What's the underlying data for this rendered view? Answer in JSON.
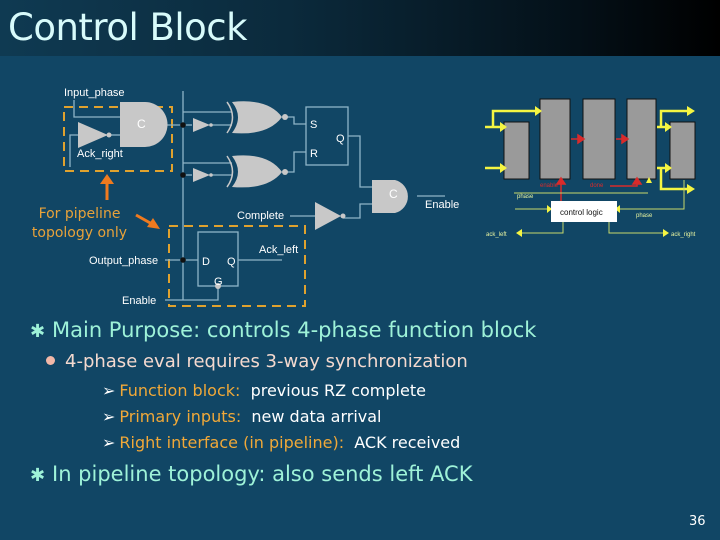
{
  "slide": {
    "title": "Control Block",
    "page_number": "36"
  },
  "circuit": {
    "labels": {
      "input_phase": "Input_phase",
      "ack_right": "Ack_right",
      "c_gate": "C",
      "s": "S",
      "r": "R",
      "q": "Q",
      "complete": "Complete",
      "enable_out": "Enable",
      "ack_left": "Ack_left",
      "output_phase": "Output_phase",
      "d": "D",
      "g": "G",
      "enable_in": "Enable"
    },
    "annotation": [
      "For pipeline",
      "topology only"
    ]
  },
  "pipeline_diagram": {
    "control_logic": "control logic",
    "phase_top": "phase",
    "phase_right": "phase",
    "ack_left": "ack_left",
    "ack_right": "ack_right",
    "enable": "enable",
    "done": "done"
  },
  "bullets": {
    "main": {
      "text": "Main Purpose:  controls 4-phase function block"
    },
    "sub": {
      "text": "4-phase eval requires 3-way synchronization"
    },
    "items": [
      {
        "key": "Function block:",
        "value": "previous RZ complete"
      },
      {
        "key": "Primary inputs:",
        "value": "new data arrival"
      },
      {
        "key": "Right interface (in pipeline):",
        "value": "ACK received"
      }
    ],
    "second": {
      "text": "In pipeline topology:  also sends left ACK"
    }
  },
  "colors": {
    "background": "#114665",
    "title_text": "#d8fbfb",
    "level1_text": "#9ef2d8",
    "level2_text": "#f4d9cf",
    "key_text": "#f0a838",
    "annotation": "#e8a23a",
    "arrow_orange": "#f07a1e",
    "gate_fill": "#c8c8c8",
    "wire": "#8fb5c8"
  }
}
